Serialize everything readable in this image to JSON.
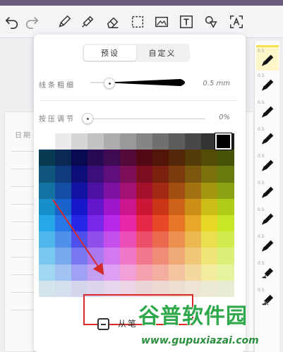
{
  "toolbar": {
    "icons": [
      "undo-icon",
      "redo-icon",
      "pen-icon",
      "highlighter-icon",
      "eraser-icon",
      "lasso-icon",
      "image-icon",
      "text-icon",
      "shape-icon",
      "ocr-icon"
    ]
  },
  "document": {
    "date_label": "日期"
  },
  "popup": {
    "tabs": [
      {
        "label": "预设",
        "active": true
      },
      {
        "label": "自定义",
        "active": false
      }
    ],
    "thickness": {
      "label": "线条粗细",
      "value": "0.5 mm"
    },
    "pressure": {
      "label": "按压调节",
      "value": "0%"
    },
    "selected_color": "#000000",
    "palette_gray_row": [
      "#ffffff",
      "#ebebeb",
      "#d6d6d6",
      "#c2c2c2",
      "#adadad",
      "#999999",
      "#858585",
      "#707070",
      "#5c5c5c",
      "#474747",
      "#333333",
      "#1f1f1f",
      "#000000"
    ],
    "option_label": "从笔"
  },
  "pen_panel": {
    "items": [
      {
        "size": "0.5",
        "icon": "fountain-pen-icon",
        "active": true
      },
      {
        "size": "0.5",
        "icon": "fountain-pen-icon",
        "active": false
      },
      {
        "size": "0.5",
        "icon": "fountain-pen-icon",
        "active": false
      },
      {
        "size": "0.5",
        "icon": "fountain-pen-icon",
        "active": false
      },
      {
        "size": "0.5",
        "icon": "fountain-pen-icon",
        "active": false
      },
      {
        "size": "0.5",
        "icon": "fountain-pen-icon",
        "active": false
      },
      {
        "size": "0.5",
        "icon": "fountain-pen-icon",
        "active": false
      },
      {
        "size": "0.5",
        "icon": "fountain-pen-icon",
        "active": false
      },
      {
        "size": "0.5",
        "icon": "marker-icon",
        "active": false
      },
      {
        "size": "0.5",
        "icon": "marker-icon",
        "active": false
      }
    ],
    "close_label": "×"
  },
  "watermark": {
    "logo": "谷普软件园",
    "url": "www.gupuxiazai.com"
  }
}
